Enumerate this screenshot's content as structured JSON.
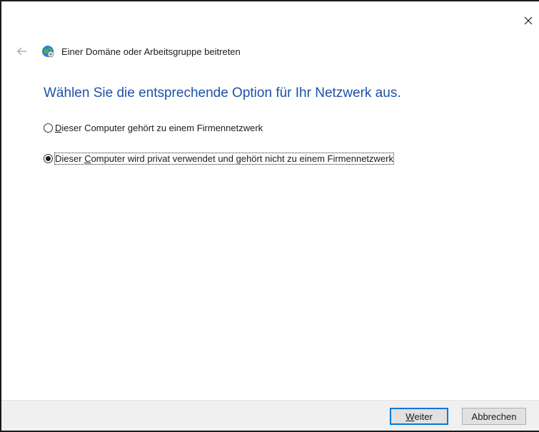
{
  "window": {
    "title": "Einer Domäne oder Arbeitsgruppe beitreten",
    "close_icon": "close-icon",
    "back_icon": "back-arrow-icon",
    "title_icon": "network-globe-icon"
  },
  "main": {
    "heading": "Wählen Sie die entsprechende Option für Ihr Netzwerk aus.",
    "options": [
      {
        "label_ul": "D",
        "label_rest": "ieser Computer gehört zu einem Firmennetzwerk",
        "selected": false
      },
      {
        "label_pre": "Dieser ",
        "label_ul": "C",
        "label_rest": "omputer wird privat verwendet und gehört nicht zu einem Firmennetzwerk",
        "selected": true
      }
    ]
  },
  "footer": {
    "next_ul": "W",
    "next_rest": "eiter",
    "cancel_label": "Abbrechen"
  },
  "colors": {
    "heading": "#1d51a8",
    "accent": "#0078d7",
    "footer_bg": "#f0f0f0"
  }
}
